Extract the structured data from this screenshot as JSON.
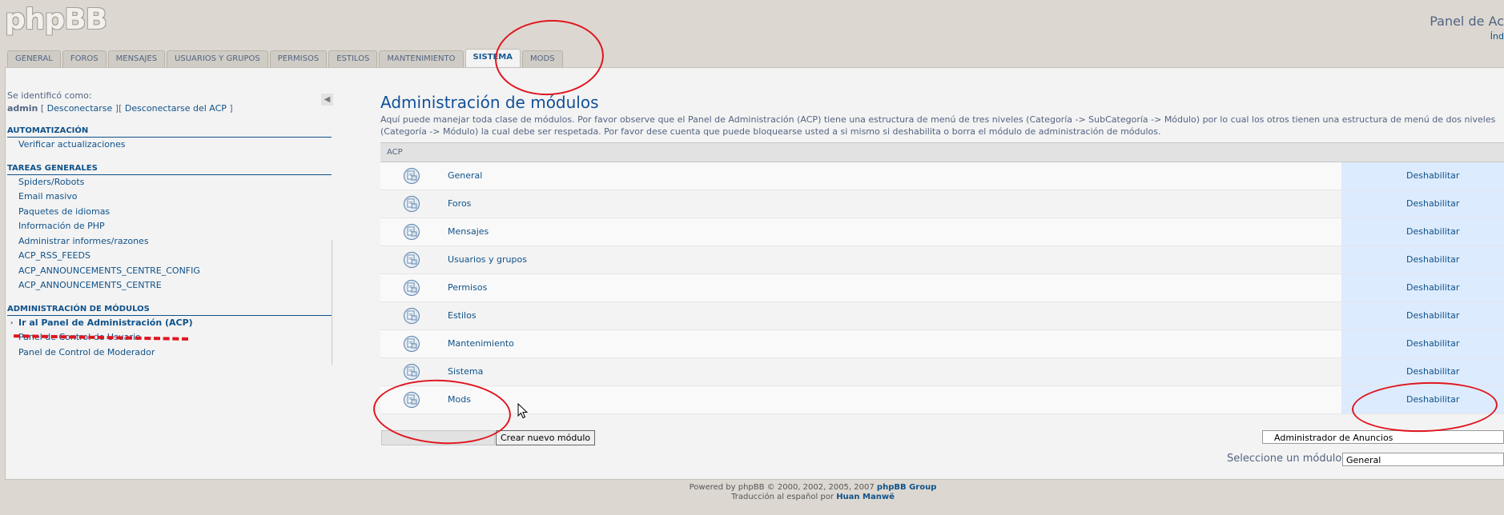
{
  "header": {
    "logo_text": "phpBB",
    "panel_title": "Panel de Ac",
    "index_link": "Índ"
  },
  "tabs": [
    {
      "label": "GENERAL",
      "active": false
    },
    {
      "label": "FOROS",
      "active": false
    },
    {
      "label": "MENSAJES",
      "active": false
    },
    {
      "label": "USUARIOS Y GRUPOS",
      "active": false
    },
    {
      "label": "PERMISOS",
      "active": false
    },
    {
      "label": "ESTILOS",
      "active": false
    },
    {
      "label": "MANTENIMIENTO",
      "active": false
    },
    {
      "label": "SISTEMA",
      "active": true
    },
    {
      "label": "MODS",
      "active": false
    }
  ],
  "sidebar": {
    "logged_as": "Se identificó como:",
    "username": "admin",
    "logout_link": "Desconectarse",
    "logout_acp_link": "Desconectarse  del ACP",
    "sections": [
      {
        "title": "AUTOMATIZACIÓN",
        "items": [
          "Verificar actualizaciones"
        ]
      },
      {
        "title": "TAREAS GENERALES",
        "items": [
          "Spiders/Robots",
          "Email masivo",
          "Paquetes de idiomas",
          "Información de PHP",
          "Administrar informes/razones",
          "ACP_RSS_FEEDS",
          "ACP_ANNOUNCEMENTS_CENTRE_CONFIG",
          "ACP_ANNOUNCEMENTS_CENTRE"
        ]
      },
      {
        "title": "ADMINISTRACIÓN DE MÓDULOS",
        "items": [
          "Ir al Panel de Administración (ACP)",
          "Panel de Control de Usuario",
          "Panel de Control de Moderador"
        ]
      }
    ]
  },
  "main": {
    "title": "Administración de módulos",
    "description": "Aquí puede manejar toda clase de módulos. Por favor observe que el Panel de Administración (ACP) tiene una estructura de menú de tres niveles (Categoría -> SubCategoría -> Módulo) por lo cual los otros tienen una estructura de menú de dos niveles (Categoría -> Módulo) la cual debe ser respetada. Por favor dese cuenta que puede bloquearse usted a si mismo si deshabilita o borra el módulo de administración de módulos.",
    "table_header": "ACP",
    "action_label": "Deshabilitar",
    "modules": [
      "General",
      "Foros",
      "Mensajes",
      "Usuarios y grupos",
      "Permisos",
      "Estilos",
      "Mantenimiento",
      "Sistema",
      "Mods"
    ]
  },
  "form": {
    "create_button": "Crear nuevo módulo",
    "announce_select": "Administrador de Anuncios",
    "select_label": "Seleccione un módulo:",
    "select_value": "General"
  },
  "footer": {
    "powered_prefix": "Powered by phpBB © 2000, 2002, 2005, 2007",
    "powered_group": "phpBB Group",
    "translation_prefix": "Traducción al español por",
    "translator": "Huan Manwë"
  },
  "colors": {
    "accent": "#105289",
    "annotation": "#e0161f"
  }
}
